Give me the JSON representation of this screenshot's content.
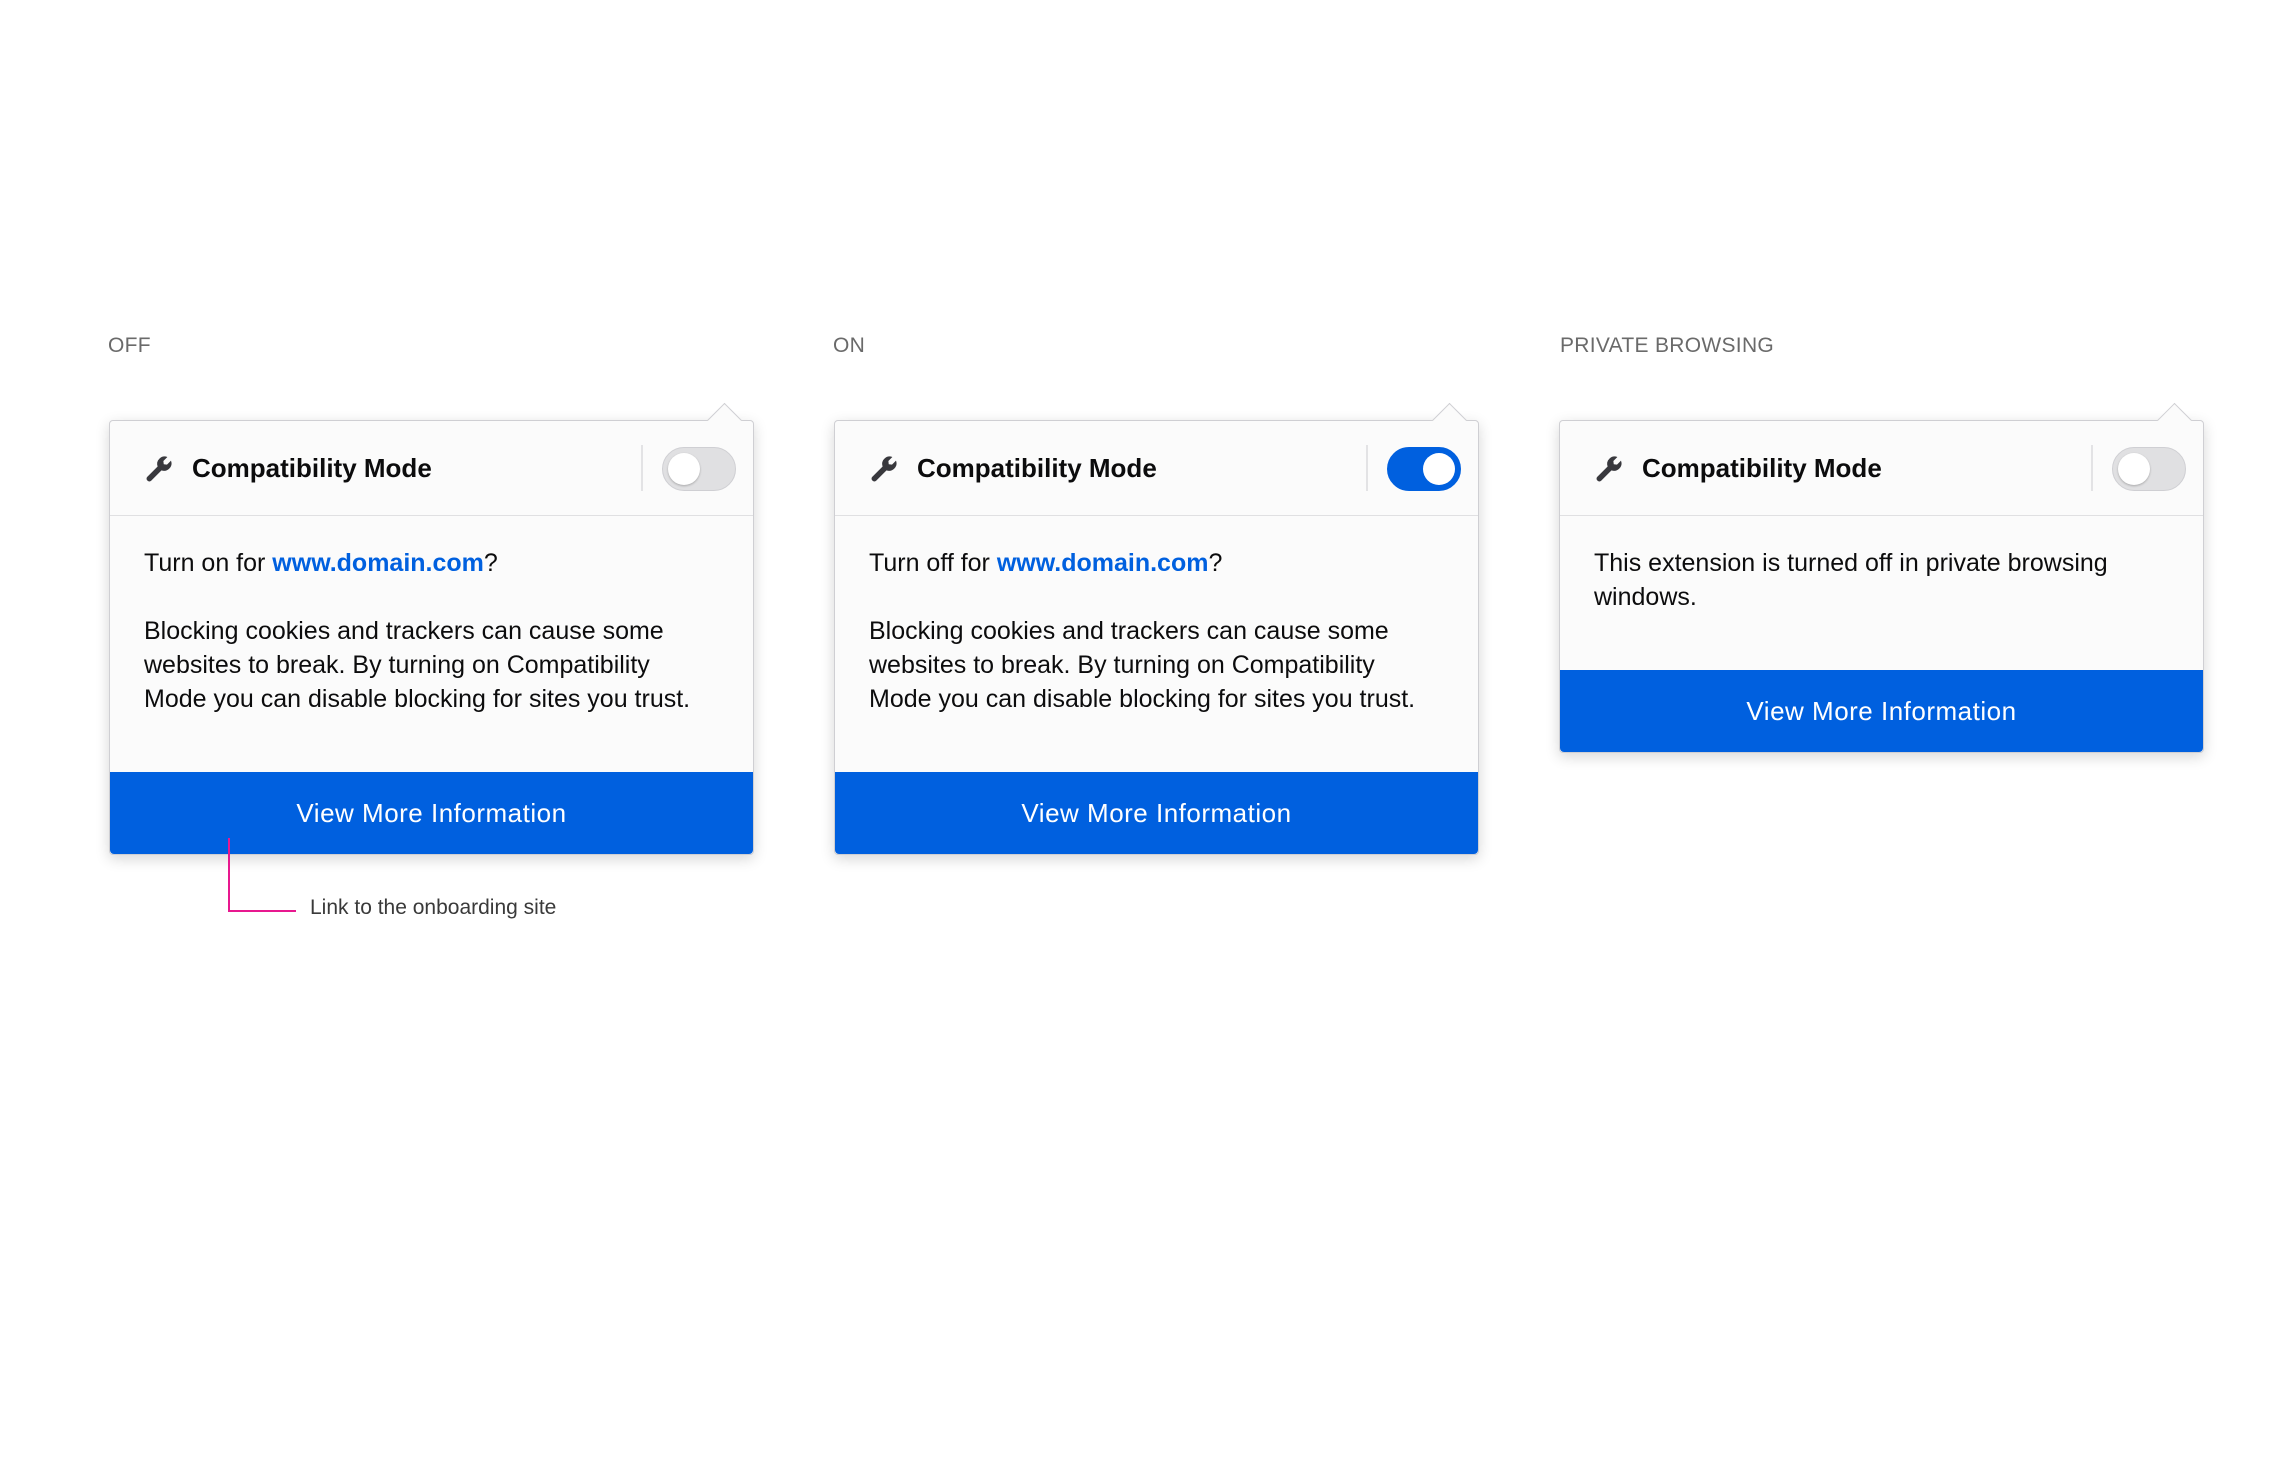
{
  "states": [
    {
      "label": "OFF",
      "title": "Compatibility Mode",
      "toggle_on": false,
      "prefix": "Turn on for ",
      "domain": "www.domain.com",
      "suffix": "?",
      "description": "Blocking cookies and trackers can cause some websites to break. By turning on Compatibility Mode you can disable blocking for sites you trust.",
      "button": "View More Information"
    },
    {
      "label": "ON",
      "title": "Compatibility Mode",
      "toggle_on": true,
      "prefix": "Turn off for ",
      "domain": "www.domain.com",
      "suffix": "?",
      "description": "Blocking cookies and trackers can cause some websites to break. By turning on Compatibility Mode you can disable blocking for sites you trust.",
      "button": "View More Information"
    },
    {
      "label": "PRIVATE BROWSING",
      "title": "Compatibility Mode",
      "toggle_on": false,
      "message": "This extension is turned off in private browsing windows.",
      "button": "View More Information"
    }
  ],
  "annotation": {
    "text": "Link to the onboarding site",
    "color": "#e8188f"
  },
  "colors": {
    "accent": "#0060df",
    "toggle_off": "#e0e0e2",
    "panel_bg": "#fbfbfb"
  },
  "icons": {
    "header": "wrench-icon"
  }
}
